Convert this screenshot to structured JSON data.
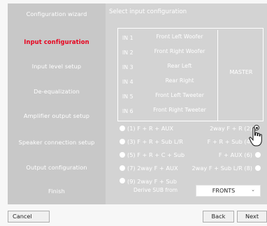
{
  "sidebar": {
    "items": [
      {
        "label": "Configuration wizard",
        "active": false
      },
      {
        "label": "Input configuration",
        "active": true
      },
      {
        "label": "Input level setup",
        "active": false
      },
      {
        "label": "De-equalization",
        "active": false
      },
      {
        "label": "Amplifier output setup",
        "active": false
      },
      {
        "label": "Speaker connection setup",
        "active": false
      },
      {
        "label": "Output configuration",
        "active": false
      },
      {
        "label": "Finish",
        "active": false
      }
    ]
  },
  "main": {
    "title": "Select input configuration",
    "inputs": [
      {
        "id": "IN 1",
        "name": "Front Left Woofer"
      },
      {
        "id": "IN 2",
        "name": "Front Right Woofer"
      },
      {
        "id": "IN 3",
        "name": "Rear Left"
      },
      {
        "id": "IN 4",
        "name": "Rear Right"
      },
      {
        "id": "IN 5",
        "name": "Front Left Tweeter"
      },
      {
        "id": "IN 6",
        "name": "Front Right Tweeter"
      }
    ],
    "master_label": "MASTER",
    "options_left": [
      {
        "label": "(1) F + R + AUX",
        "selected": false
      },
      {
        "label": "(3) F + R + Sub L/R",
        "selected": false
      },
      {
        "label": "(5) F + R + C + Sub",
        "selected": false
      },
      {
        "label": "(7) 2way F + AUX",
        "selected": false
      },
      {
        "label": "(9) 2way F + Sub",
        "selected": false
      }
    ],
    "options_right": [
      {
        "label": "2way F + R (2)",
        "selected": true
      },
      {
        "label": "F + R + Sub (4)",
        "selected": false
      },
      {
        "label": "F + AUX (6)",
        "selected": false
      },
      {
        "label": "2way F + Sub L/R (8)",
        "selected": false
      }
    ],
    "derive_label": "Derive SUB from",
    "derive_value": "FRONTS"
  },
  "footer": {
    "cancel_label": "Cancel",
    "back_label": "Back",
    "next_label": "Next"
  },
  "colors": {
    "active_item": "#e8001c",
    "panel": "#d3d3d3",
    "sidebar": "#c8c8c8"
  }
}
